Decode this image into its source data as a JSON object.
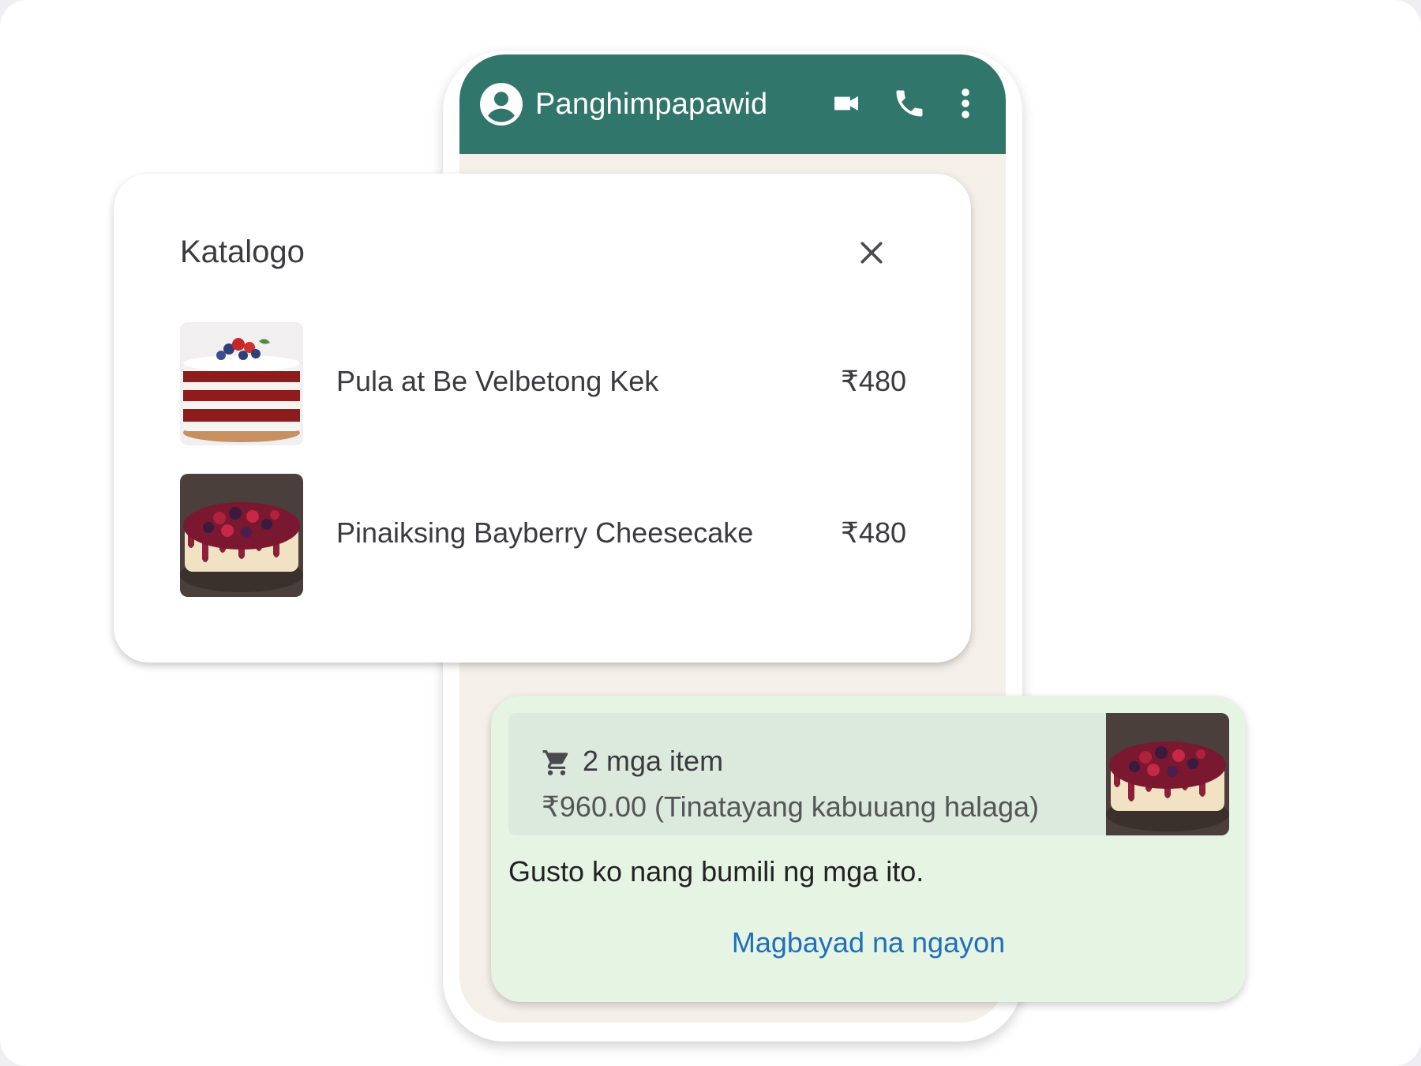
{
  "chat": {
    "contact_name": "Panghimpapawid",
    "icons": [
      "account-icon",
      "video-call-icon",
      "phone-icon",
      "more-vert-icon"
    ],
    "header_color": "#31766a",
    "background_color": "#f5efe9"
  },
  "catalog": {
    "title": "Katalogo",
    "close_icon": "close-icon",
    "products": [
      {
        "name": "Pula at Be Velbetong Kek",
        "price": "₹480",
        "image": "red-velvet-cake"
      },
      {
        "name": "Pinaiksing Bayberry Cheesecake",
        "price": "₹480",
        "image": "berry-cheesecake"
      }
    ]
  },
  "order": {
    "cart_icon": "cart-icon",
    "item_count": "2 mga item",
    "total": "₹960.00 (Tinatayang kabuuang halaga)",
    "message": "Gusto ko nang bumili ng mga ito.",
    "pay_label": "Magbayad na ngayon",
    "bubble_color": "#e6f4e4",
    "link_color": "#1f6fbd"
  }
}
